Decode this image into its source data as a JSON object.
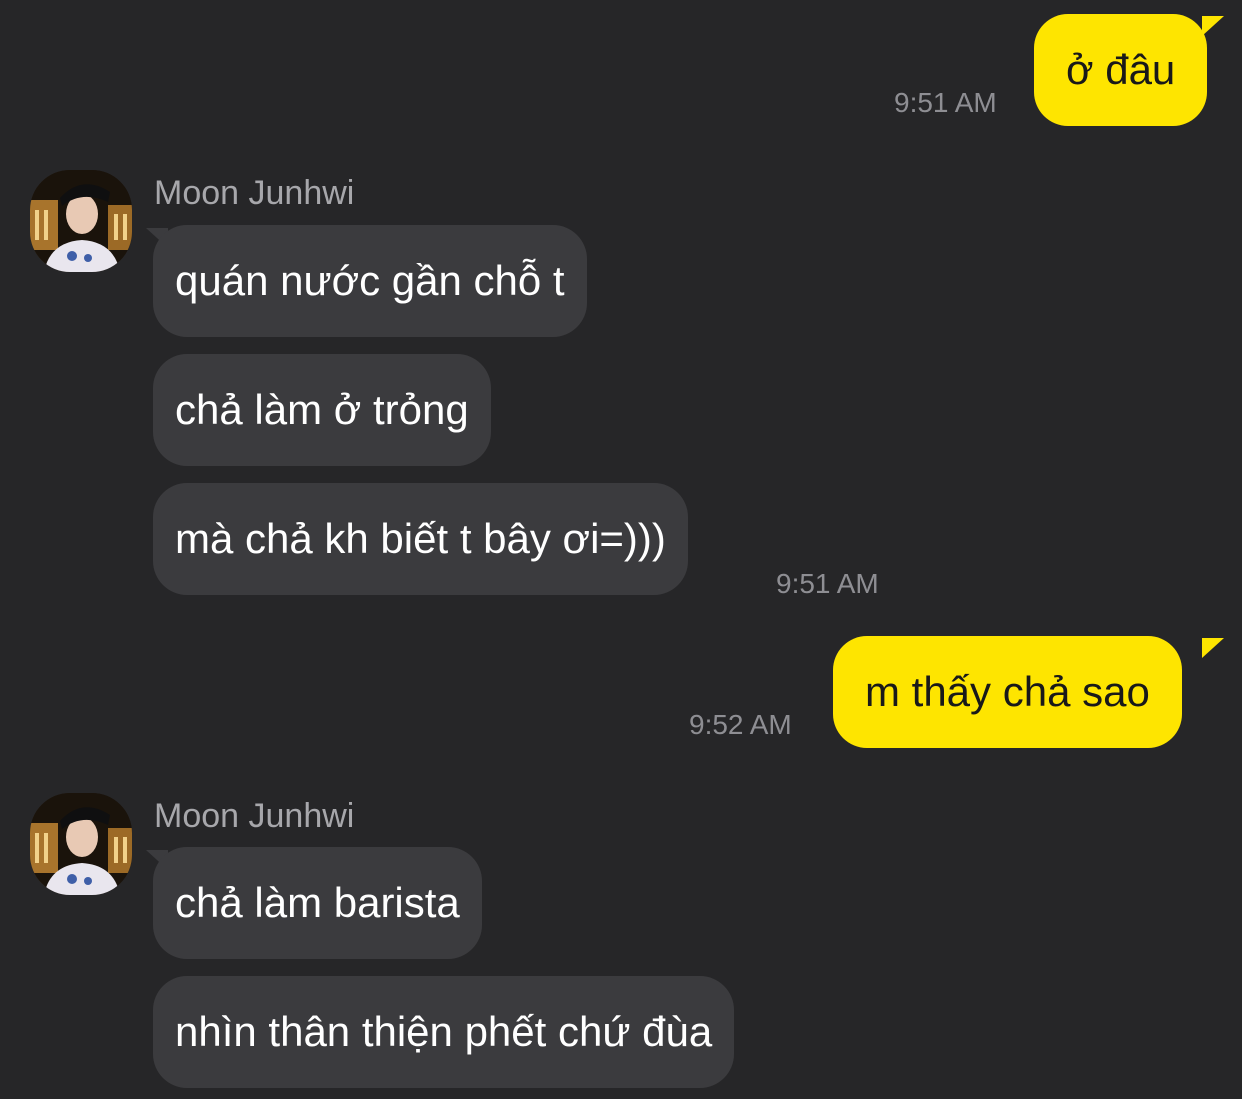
{
  "conversation": {
    "contact_name": "Moon Junhwi",
    "messages": [
      {
        "from": "me",
        "text": "ở đâu",
        "time": "9:51 AM"
      },
      {
        "from": "contact",
        "text": "quán nước gần chỗ t"
      },
      {
        "from": "contact",
        "text": "chả làm ở trỏng"
      },
      {
        "from": "contact",
        "text": "mà chả kh biết t bây ơi=)))",
        "time": "9:51 AM"
      },
      {
        "from": "me",
        "text": "m thấy chả sao",
        "time": "9:52 AM"
      },
      {
        "from": "contact",
        "text": "chả làm barista"
      },
      {
        "from": "contact",
        "text": "nhìn thân thiện phết chứ đùa"
      }
    ]
  },
  "colors": {
    "background": "#262628",
    "incoming_bubble": "#3b3b3e",
    "outgoing_bubble": "#fee500",
    "timestamp": "#8e8e93"
  },
  "icons": {
    "avatar": "contact-avatar-photo"
  }
}
